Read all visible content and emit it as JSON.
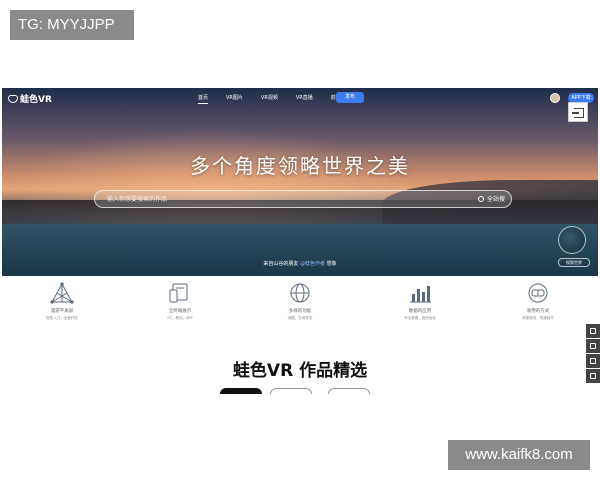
{
  "overlay": {
    "tg_label": "TG: MYYJJPP",
    "watermark": "www.kaifk8.com"
  },
  "nav": {
    "logo": "蛙色VR",
    "items": [
      "首页",
      "VR图片",
      "VR视频",
      "VR直播",
      "前言"
    ],
    "publish_label": "发布",
    "app_label": "APP下载"
  },
  "hero": {
    "headline": "多个角度领略世界之美",
    "search_placeholder": "输入你想要搜索的作品",
    "search_button": "全站搜",
    "caption_prefix": "来自山谷的朋友 ",
    "caption_highlight": "@蛙色作者",
    "caption_suffix": " 想象",
    "globe_label": "探索世界"
  },
  "features": [
    {
      "title": "漫游不离屏",
      "subtitle": "轻松入门，全面开放",
      "icon": "network-icon"
    },
    {
      "title": "全终端展示",
      "subtitle": "PC，移动，APP",
      "icon": "devices-icon"
    },
    {
      "title": "多样的功能",
      "subtitle": "地图，空间导览",
      "icon": "globe-icon"
    },
    {
      "title": "数据的应用",
      "subtitle": "专业数据，逐月优化",
      "icon": "bar-chart-icon"
    },
    {
      "title": "易用的方式",
      "subtitle": "简便使用，快速制作",
      "icon": "vr-headset-icon"
    }
  ],
  "sidebar": {
    "icons": [
      "chat-icon",
      "qr-code-icon",
      "phone-icon",
      "call-icon"
    ]
  },
  "section": {
    "title": "蛙色VR 作品精选"
  },
  "colors": {
    "accent": "#3d7cf0",
    "dark": "#111111"
  }
}
